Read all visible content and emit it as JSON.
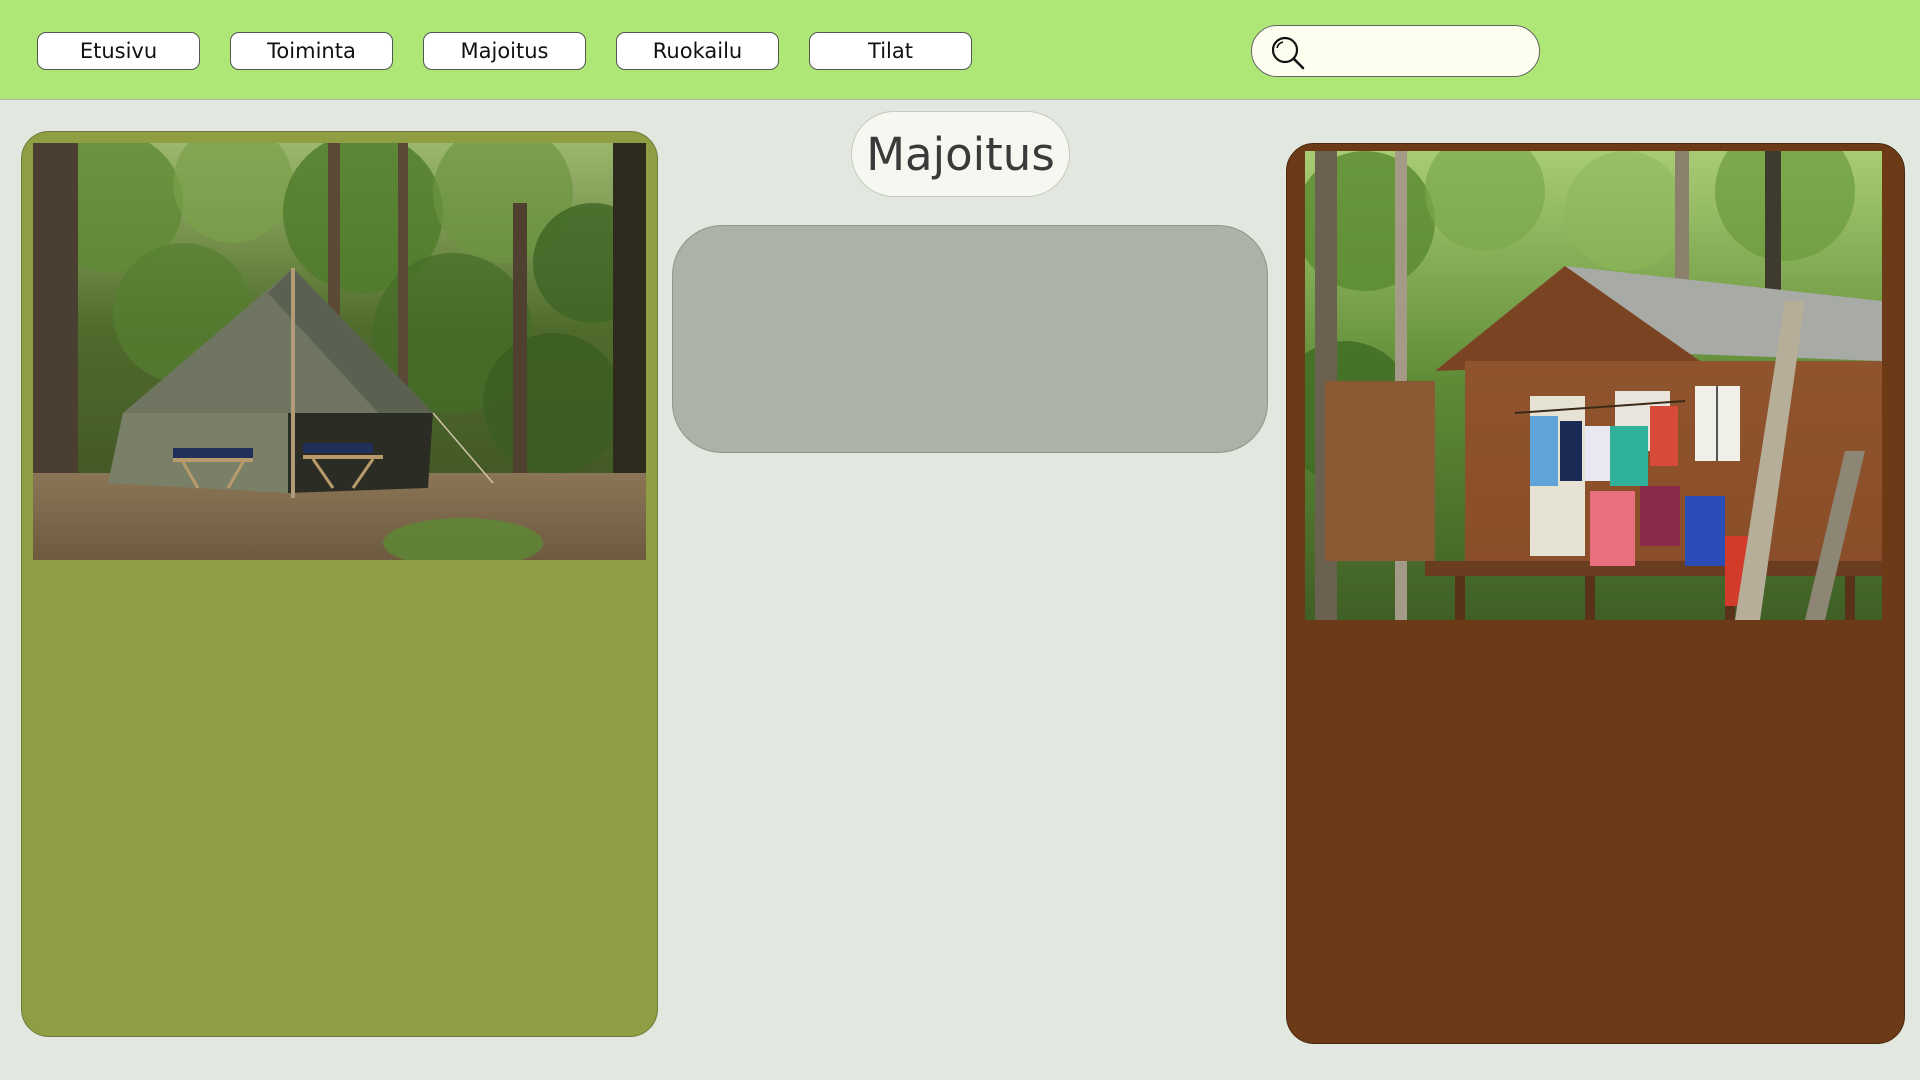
{
  "nav": {
    "items": [
      {
        "label": "Etusivu"
      },
      {
        "label": "Toiminta"
      },
      {
        "label": "Majoitus"
      },
      {
        "label": "Ruokailu"
      },
      {
        "label": "Tilat"
      }
    ]
  },
  "search": {
    "icon": "search-icon",
    "value": "",
    "placeholder": ""
  },
  "main": {
    "title": "Majoitus",
    "left_card": {
      "image": "tent-in-forest-photo",
      "color": "#8f9e42"
    },
    "right_card": {
      "image": "wooden-cabin-photo",
      "color": "#6c3a16"
    },
    "info_box": {
      "color": "#abb3a6"
    }
  },
  "colors": {
    "topbar": "#aee776",
    "background": "#e2e8df"
  }
}
